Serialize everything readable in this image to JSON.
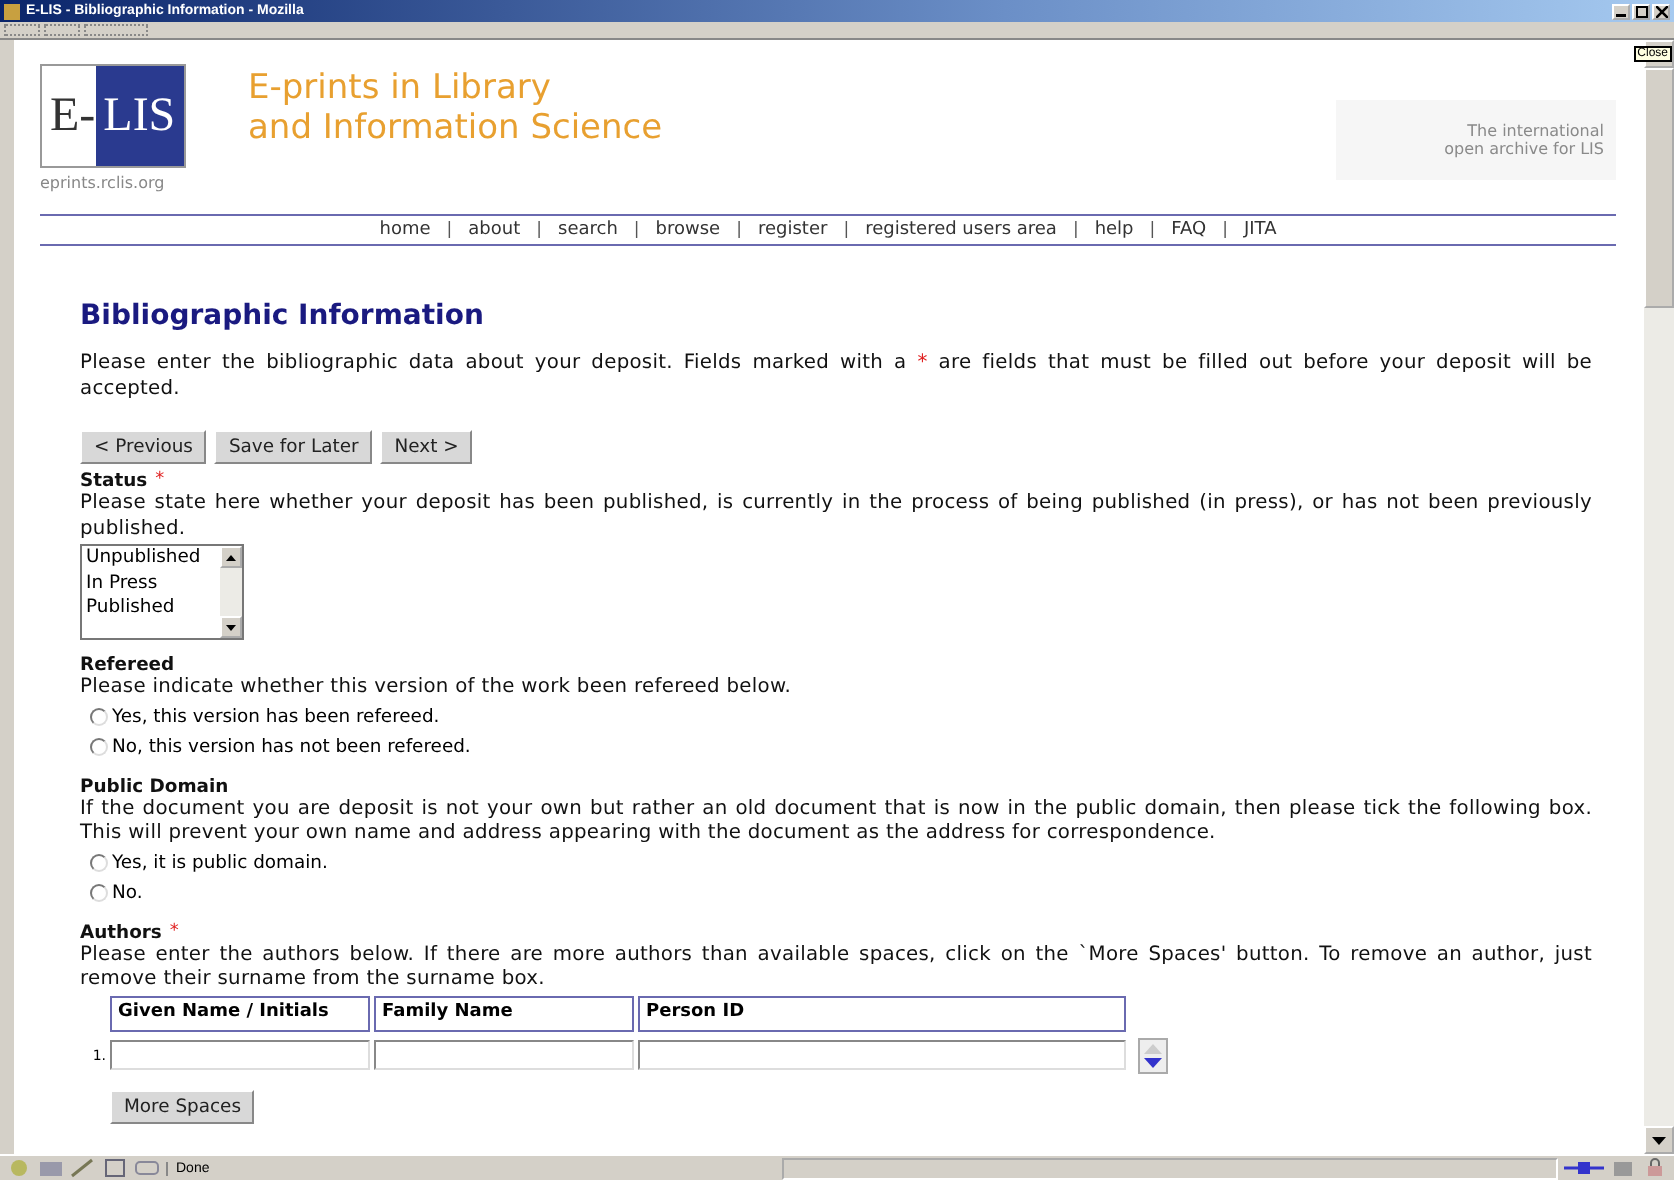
{
  "window": {
    "title": "E-LIS - Bibliographic Information - Mozilla",
    "tooltip": "Close"
  },
  "header": {
    "logo_left": "E-",
    "logo_right": "LIS",
    "url": "eprints.rclis.org",
    "title_lines": [
      "E-prints in Library",
      "and Information Science"
    ],
    "tagline_lines": [
      "The international",
      "open archive for LIS"
    ]
  },
  "nav": [
    {
      "kind": "link",
      "text": "home"
    },
    {
      "kind": "separator",
      "text": "|"
    },
    {
      "kind": "link",
      "text": "about"
    },
    {
      "kind": "separator",
      "text": "|"
    },
    {
      "kind": "link",
      "text": "search"
    },
    {
      "kind": "separator",
      "text": "|"
    },
    {
      "kind": "link",
      "text": "browse"
    },
    {
      "kind": "separator",
      "text": "|"
    },
    {
      "kind": "link",
      "text": "register"
    },
    {
      "kind": "separator",
      "text": "|"
    },
    {
      "kind": "link",
      "text": "registered users area"
    },
    {
      "kind": "separator",
      "text": "|"
    },
    {
      "kind": "link",
      "text": "help"
    },
    {
      "kind": "separator",
      "text": "|"
    },
    {
      "kind": "link",
      "text": "FAQ"
    },
    {
      "kind": "separator",
      "text": "|"
    },
    {
      "kind": "link",
      "text": "JITA"
    }
  ],
  "heading": "Bibliographic Information",
  "intro": {
    "before": "Please enter the bibliographic data about your deposit. Fields marked with a",
    "mark": "*",
    "after": "are fields that must be filled out before your deposit will be accepted."
  },
  "buttons": [
    "< Previous",
    "Save for Later",
    "Next >"
  ],
  "sections": [
    {
      "kind": "listbox",
      "label": "Status",
      "required_mark": "*",
      "help": "Please state here whether your deposit has been published, is currently in the process of being published (in press), or has not been previously published.",
      "options": [
        {
          "label": "Unpublished",
          "selected": false
        },
        {
          "label": "In Press",
          "selected": false
        },
        {
          "label": "Published",
          "selected": false
        }
      ]
    },
    {
      "kind": "radio",
      "label": "Refereed",
      "help": "Please indicate whether this version of the work been refereed below.",
      "options": [
        {
          "label": "Yes, this version has been refereed.",
          "selected": false
        },
        {
          "label": "No, this version has not been refereed.",
          "selected": false
        }
      ]
    },
    {
      "kind": "radio",
      "label": "Public Domain",
      "help": "If the document you are deposit is not your own but rather an old document that is now in the public domain, then please tick the following box. This will prevent your own name and address appearing with the document as the address for correspondence.",
      "options": [
        {
          "label": "Yes, it is public domain.",
          "selected": false
        },
        {
          "label": "No.",
          "selected": false
        }
      ]
    },
    {
      "kind": "authors",
      "label": "Authors",
      "required_mark": "*",
      "help": "Please enter the authors below. If there are more authors than available spaces, click on the `More Spaces' button. To remove an author, just remove their surname from the surname box.",
      "columns": [
        "Given Name / Initials",
        "Family Name",
        "Person ID"
      ],
      "rows": [
        {
          "number": "1."
        }
      ],
      "more_button": "More Spaces"
    }
  ],
  "status_bar": {
    "text": "Done"
  }
}
